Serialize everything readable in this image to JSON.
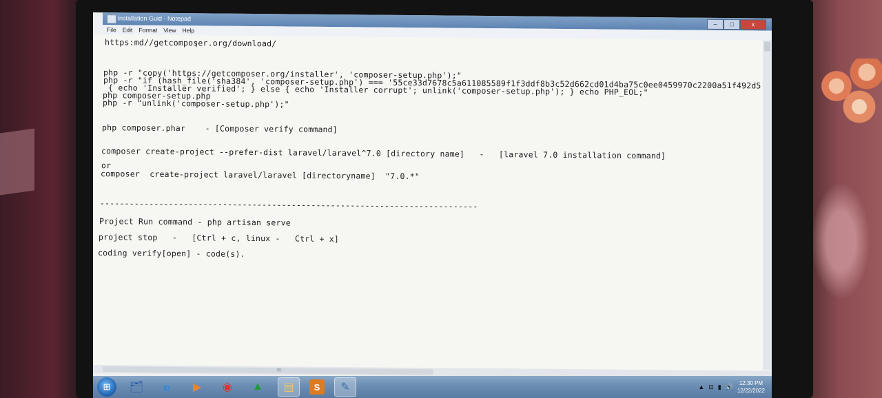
{
  "window": {
    "title": "installation Guid - Notepad",
    "controls": {
      "minimize": "–",
      "maximize": "□",
      "close": "x"
    }
  },
  "menu": [
    "File",
    "Edit",
    "Format",
    "View",
    "Help"
  ],
  "editor_lines": [
    "https:md//getcomposer.org/download/",
    "php -r \"copy('https://getcomposer.org/installer', 'composer-setup.php');\"",
    "php -r \"if (hash_file('sha384', 'composer-setup.php') === '55ce33d7678c5a611085589f1f3ddf8b3c52d662cd01d4ba75c0ee0459970c2200a51f492d5",
    " { echo 'Installer verified'; } else { echo 'Installer corrupt'; unlink('composer-setup.php'); } echo PHP_EOL;\"",
    "php composer-setup.php",
    "php -r \"unlink('composer-setup.php');\"",
    "php composer.phar    - [Composer verify command]",
    "composer create-project --prefer-dist laravel/laravel^7.0 [directory name]   -   [laravel 7.0 installation command]",
    "or",
    "composer  create-project laravel/laravel [directoryname]  \"7.0.*\"",
    "-----------------------------------------------------------------------------",
    "Project Run command - php artisan serve",
    "project stop   -   [Ctrl + c, linux -   Ctrl + x]",
    "coding verify[open] - code(s)."
  ],
  "scrollbar_grip": "III",
  "taskbar": {
    "apps": [
      {
        "name": "explorer-icon",
        "glyph": "🗂"
      },
      {
        "name": "ie-icon",
        "glyph": "e"
      },
      {
        "name": "media-player-icon",
        "glyph": "▶"
      },
      {
        "name": "chrome-icon",
        "glyph": "◉"
      },
      {
        "name": "green-app-icon",
        "glyph": "▲"
      },
      {
        "name": "folder-icon",
        "glyph": "▤"
      },
      {
        "name": "sublime-icon",
        "glyph": "S"
      },
      {
        "name": "notepad-icon",
        "glyph": "✎"
      }
    ],
    "clock_time": "12:30 PM",
    "clock_date": "12/22/2022",
    "tray": [
      "▲",
      "⊡",
      "▮",
      "🔊"
    ]
  },
  "colors": {
    "titlebar": "#6a8ebc",
    "editor_bg": "#f6f7f3",
    "taskbar": "#6d8fb4",
    "close": "#c9463d"
  }
}
